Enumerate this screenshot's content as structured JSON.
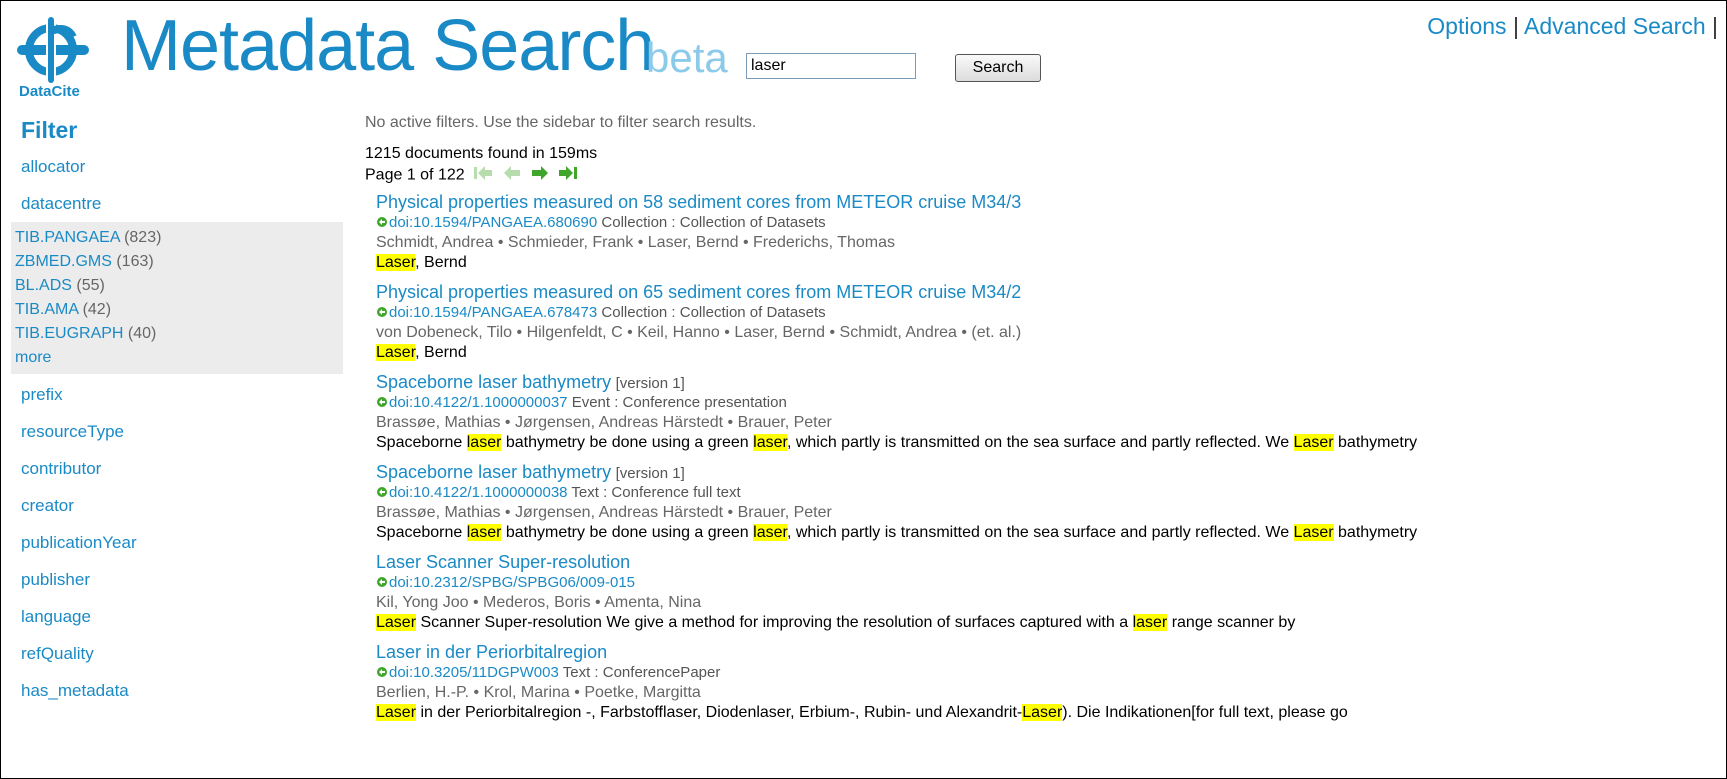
{
  "header": {
    "logo_text": "DataCite",
    "title": "Metadata Search",
    "beta": "beta",
    "search_value": "laser",
    "search_button": "Search",
    "options_link": "Options",
    "separator": "|",
    "advanced_link": "Advanced Search",
    "trailing_separator": "|"
  },
  "sidebar": {
    "title": "Filter",
    "facets": [
      "allocator",
      "datacentre",
      "prefix",
      "resourceType",
      "contributor",
      "creator",
      "publicationYear",
      "publisher",
      "language",
      "refQuality",
      "has_metadata"
    ],
    "datacentre_items": [
      {
        "name": "TIB.PANGAEA",
        "count": "(823)"
      },
      {
        "name": "ZBMED.GMS",
        "count": "(163)"
      },
      {
        "name": "BL.ADS",
        "count": "(55)"
      },
      {
        "name": "TIB.AMA",
        "count": "(42)"
      },
      {
        "name": "TIB.EUGRAPH",
        "count": "(40)"
      }
    ],
    "more": "more"
  },
  "main": {
    "no_filters": "No active filters. Use the sidebar to filter search results.",
    "doc_count": "1215 documents found in 159ms",
    "page_info": "Page 1 of 122",
    "results": [
      {
        "title": "Physical properties measured on 58 sediment cores from METEOR cruise M34/3",
        "version": "",
        "doi": "doi:10.1594/PANGAEA.680690",
        "type": "Collection : Collection of Datasets",
        "authors": "Schmidt, Andrea • Schmieder, Frank • Laser, Bernd • Frederichs, Thomas",
        "snippet": [
          {
            "t": "Laser",
            "h": true
          },
          {
            "t": ", Bernd",
            "h": false
          }
        ]
      },
      {
        "title": "Physical properties measured on 65 sediment cores from METEOR cruise M34/2",
        "version": "",
        "doi": "doi:10.1594/PANGAEA.678473",
        "type": "Collection : Collection of Datasets",
        "authors": "von Dobeneck, Tilo • Hilgenfeldt, C • Keil, Hanno • Laser, Bernd • Schmidt, Andrea • (et. al.)",
        "snippet": [
          {
            "t": "Laser",
            "h": true
          },
          {
            "t": ", Bernd",
            "h": false
          }
        ]
      },
      {
        "title": "Spaceborne laser bathymetry",
        "version": "[version 1]",
        "doi": "doi:10.4122/1.1000000037",
        "type": "Event : Conference presentation",
        "authors": "Brassøe, Mathias • Jørgensen, Andreas Härstedt • Brauer, Peter",
        "snippet": [
          {
            "t": "Spaceborne ",
            "h": false
          },
          {
            "t": "laser",
            "h": true
          },
          {
            "t": " bathymetry be done using a green ",
            "h": false
          },
          {
            "t": "laser",
            "h": true
          },
          {
            "t": ", which partly is transmitted on the sea surface and partly reflected. We ",
            "h": false
          },
          {
            "t": "Laser",
            "h": true
          },
          {
            "t": " bathymetry",
            "h": false
          }
        ]
      },
      {
        "title": "Spaceborne laser bathymetry",
        "version": "[version 1]",
        "doi": "doi:10.4122/1.1000000038",
        "type": "Text : Conference full text",
        "authors": "Brassøe, Mathias • Jørgensen, Andreas Härstedt • Brauer, Peter",
        "snippet": [
          {
            "t": "Spaceborne ",
            "h": false
          },
          {
            "t": "laser",
            "h": true
          },
          {
            "t": " bathymetry be done using a green ",
            "h": false
          },
          {
            "t": "laser",
            "h": true
          },
          {
            "t": ", which partly is transmitted on the sea surface and partly reflected. We ",
            "h": false
          },
          {
            "t": "Laser",
            "h": true
          },
          {
            "t": " bathymetry",
            "h": false
          }
        ]
      },
      {
        "title": "Laser Scanner Super-resolution",
        "version": "",
        "doi": "doi:10.2312/SPBG/SPBG06/009-015",
        "type": "",
        "authors": "Kil, Yong Joo • Mederos, Boris • Amenta, Nina",
        "snippet": [
          {
            "t": "Laser",
            "h": true
          },
          {
            "t": " Scanner Super-resolution We give a method for improving the resolution of surfaces captured with a ",
            "h": false
          },
          {
            "t": "laser",
            "h": true
          },
          {
            "t": " range scanner by",
            "h": false
          }
        ]
      },
      {
        "title": "Laser in der Periorbitalregion",
        "version": "",
        "doi": "doi:10.3205/11DGPW003",
        "type": "Text : ConferencePaper",
        "authors": "Berlien, H.-P. • Krol, Marina • Poetke, Margitta",
        "snippet": [
          {
            "t": "Laser",
            "h": true
          },
          {
            "t": " in der Periorbitalregion -, Farbstofflaser, Diodenlaser, Erbium-, Rubin- und Alexandrit-",
            "h": false
          },
          {
            "t": "Laser",
            "h": true
          },
          {
            "t": "). Die Indikationen[for full text, please go",
            "h": false
          }
        ]
      }
    ]
  },
  "colors": {
    "brand": "#1a8ac6",
    "beta": "#8ccaea",
    "highlight": "#ffff00",
    "facet_box": "#ececec"
  }
}
